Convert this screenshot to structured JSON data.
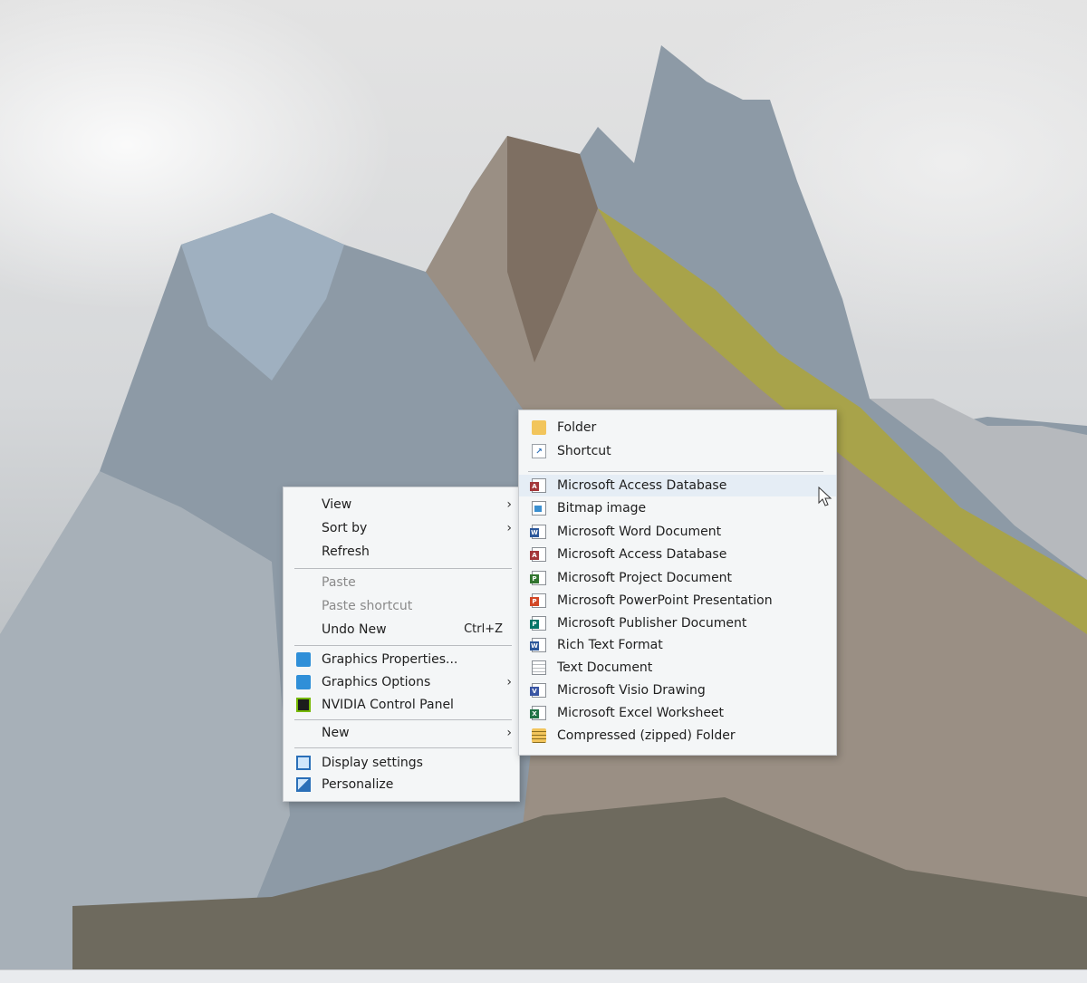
{
  "context_menu": {
    "items": [
      {
        "label": "View"
      },
      {
        "label": "Sort by"
      },
      {
        "label": "Refresh"
      },
      {
        "label": "Paste"
      },
      {
        "label": "Paste shortcut"
      },
      {
        "label": "Undo New",
        "shortcut": "Ctrl+Z"
      },
      {
        "label": "Graphics Properties..."
      },
      {
        "label": "Graphics Options"
      },
      {
        "label": "NVIDIA Control Panel"
      },
      {
        "label": "New"
      },
      {
        "label": "Display settings"
      },
      {
        "label": "Personalize"
      }
    ]
  },
  "new_submenu": {
    "items": [
      {
        "label": "Folder"
      },
      {
        "label": "Shortcut"
      },
      {
        "label": "Microsoft Access Database"
      },
      {
        "label": "Bitmap image"
      },
      {
        "label": "Microsoft Word Document"
      },
      {
        "label": "Microsoft Access Database"
      },
      {
        "label": "Microsoft Project Document"
      },
      {
        "label": "Microsoft PowerPoint Presentation"
      },
      {
        "label": "Microsoft Publisher Document"
      },
      {
        "label": "Rich Text Format"
      },
      {
        "label": "Text Document"
      },
      {
        "label": "Microsoft Visio Drawing"
      },
      {
        "label": "Microsoft Excel Worksheet"
      },
      {
        "label": "Compressed (zipped) Folder"
      }
    ]
  },
  "icons": {
    "folder": "folder-icon",
    "shortcut": "shortcut-icon",
    "access": "access-icon",
    "bitmap": "bitmap-icon",
    "word": "word-icon",
    "project": "project-icon",
    "powerpoint": "powerpoint-icon",
    "publisher": "publisher-icon",
    "rtf": "rich-text-icon",
    "text": "text-document-icon",
    "visio": "visio-icon",
    "excel": "excel-icon",
    "zip": "zip-folder-icon",
    "graphics_properties": "intel-graphics-icon",
    "graphics_options": "intel-graphics-icon",
    "nvidia": "nvidia-icon",
    "display": "display-icon",
    "personalize": "personalize-icon"
  },
  "colors": {
    "access": "#a4373a",
    "word": "#2b579a",
    "project": "#31752f",
    "powerpoint": "#d24726",
    "publisher": "#077568",
    "visio": "#3955a3",
    "excel": "#217346",
    "folder": "#f2c55c",
    "nvidia": "#76b900"
  }
}
